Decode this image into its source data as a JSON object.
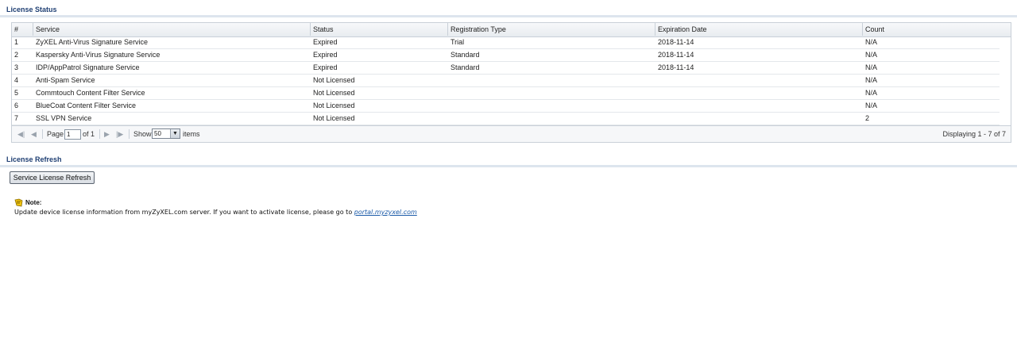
{
  "license_status": {
    "title": "License Status",
    "columns": [
      "#",
      "Service",
      "Status",
      "Registration Type",
      "Expiration Date",
      "Count"
    ],
    "rows": [
      {
        "num": "1",
        "service": "ZyXEL Anti-Virus Signature Service",
        "status": "Expired",
        "reg_type": "Trial",
        "expiration": "2018-11-14",
        "count": "N/A"
      },
      {
        "num": "2",
        "service": "Kaspersky Anti-Virus Signature Service",
        "status": "Expired",
        "reg_type": "Standard",
        "expiration": "2018-11-14",
        "count": "N/A"
      },
      {
        "num": "3",
        "service": "IDP/AppPatrol Signature Service",
        "status": "Expired",
        "reg_type": "Standard",
        "expiration": "2018-11-14",
        "count": "N/A"
      },
      {
        "num": "4",
        "service": "Anti-Spam Service",
        "status": "Not Licensed",
        "reg_type": "",
        "expiration": "",
        "count": "N/A"
      },
      {
        "num": "5",
        "service": "Commtouch Content Filter Service",
        "status": "Not Licensed",
        "reg_type": "",
        "expiration": "",
        "count": "N/A"
      },
      {
        "num": "6",
        "service": "BlueCoat Content Filter Service",
        "status": "Not Licensed",
        "reg_type": "",
        "expiration": "",
        "count": "N/A"
      },
      {
        "num": "7",
        "service": "SSL VPN Service",
        "status": "Not Licensed",
        "reg_type": "",
        "expiration": "",
        "count": "2"
      }
    ],
    "pager": {
      "page_label": "Page",
      "page_value": "1",
      "of_label": "of 1",
      "show_label": "Show",
      "show_value": "50",
      "items_label": "items",
      "displaying": "Displaying 1 - 7 of 7"
    }
  },
  "license_refresh": {
    "title": "License Refresh",
    "button_label": "Service License Refresh"
  },
  "note": {
    "label": "Note:",
    "text": "Update device license information from myZyXEL.com server. If you want to activate license, please go to ",
    "link_text": "portal.myzyxel.com"
  },
  "colors": {
    "section_title": "#1f3f73",
    "link": "#1a5aa8",
    "grid_border": "#c9d0d8"
  },
  "icons": [
    "first-page-icon",
    "prev-page-icon",
    "next-page-icon",
    "last-page-icon",
    "dropdown-arrow-icon",
    "note-icon"
  ]
}
